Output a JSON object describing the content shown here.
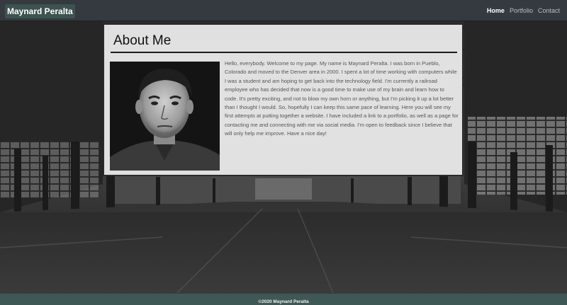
{
  "navbar": {
    "brand": "Maynard Peralta",
    "links": [
      {
        "label": "Home",
        "active": true
      },
      {
        "label": "Portfolio",
        "active": false
      },
      {
        "label": "Contact",
        "active": false
      }
    ]
  },
  "about": {
    "title": "About Me",
    "bio": "Hello, everybody. Welcome to my page. My name is Maynard Peralta. I was born in Pueblo, Colorado and moved to the Denver area in 2000. I spent a lot of time working with computers while I was a student and am hoping to get back into the technology field. I'm currently a railroad employee who has decided that now is a good time to make use of my brain and learn how to code. It's pretty exciting, and not to blow my own horn or anything, but I'm picking it up a lot better than I thought I would. So, hopefully I can keep this same pace of learning. Here you will see my first attempts at putting together a website. I have included a link to a portfolio, as well as a page for contacting me and connecting with me via social media. I'm open to feedback since I believe that will only help me improve. Have a nice day!"
  },
  "footer": {
    "text": "©2020 Maynard Peralta"
  },
  "colors": {
    "navbar_bg": "#343a40",
    "brand_bg": "#3c5350",
    "footer_bg": "#3e5855",
    "card_bg": "#e8e8e8"
  }
}
